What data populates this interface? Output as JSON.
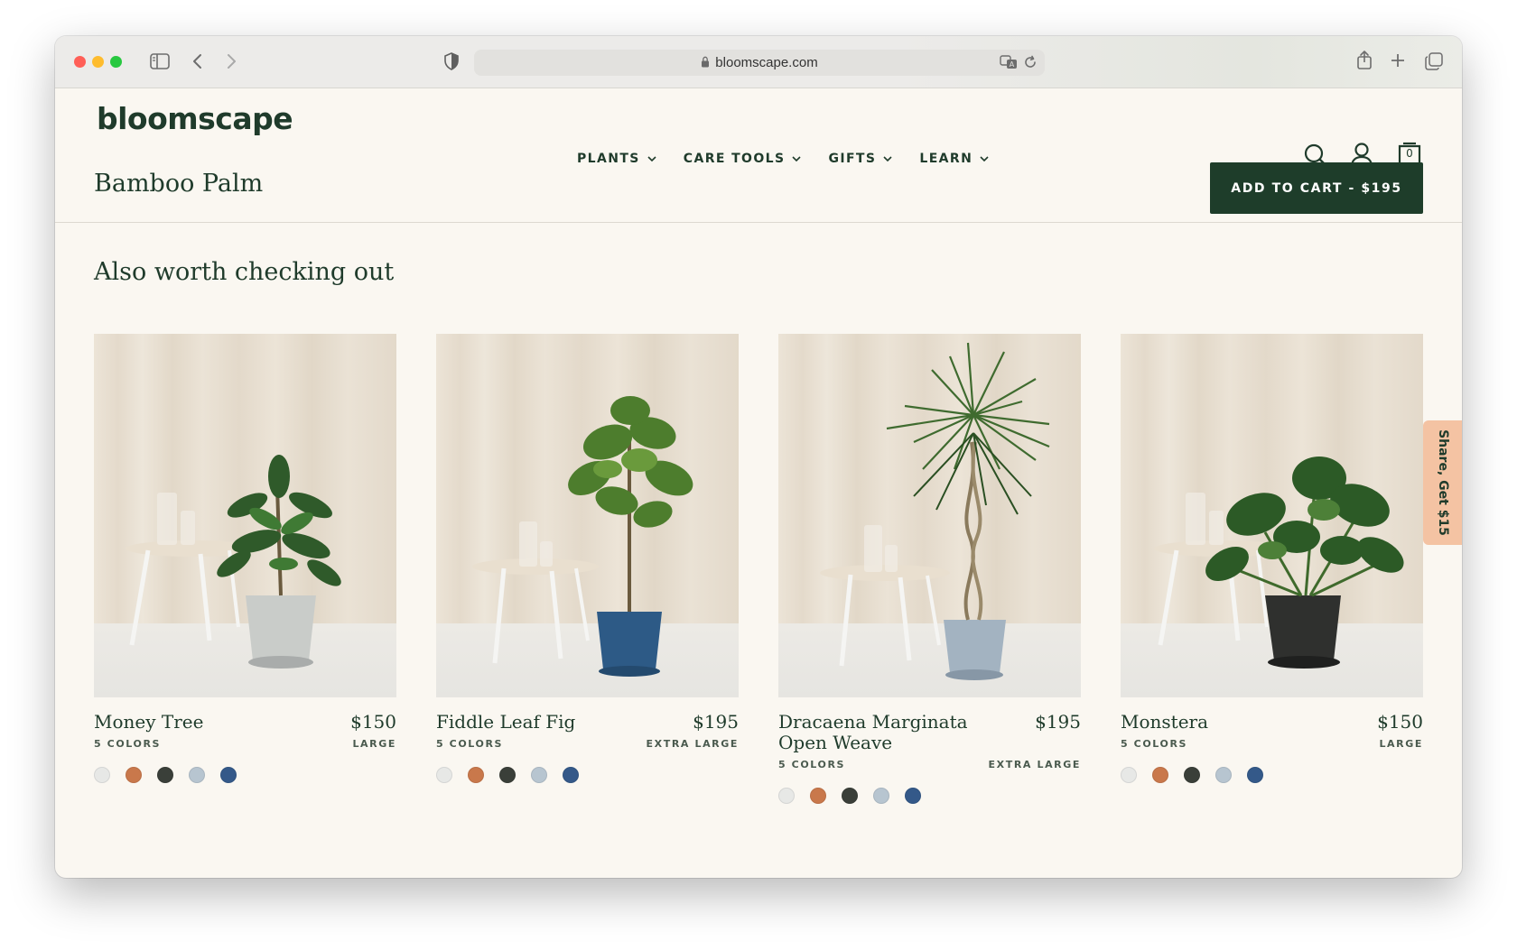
{
  "browser": {
    "url": "bloomscape.com"
  },
  "site": {
    "logo": "bloomscape",
    "nav": [
      {
        "label": "PLANTS"
      },
      {
        "label": "CARE TOOLS"
      },
      {
        "label": "GIFTS"
      },
      {
        "label": "LEARN"
      }
    ],
    "cart_count": "0"
  },
  "product": {
    "title": "Bamboo Palm",
    "add_to_cart_label": "ADD TO CART - $195"
  },
  "recommendations": {
    "title": "Also worth checking out",
    "items": [
      {
        "name": "Money Tree",
        "price": "$150",
        "colors": "5 COLORS",
        "size": "LARGE",
        "pot_color": "#c9ccc9"
      },
      {
        "name": "Fiddle Leaf Fig",
        "price": "$195",
        "colors": "5 COLORS",
        "size": "EXTRA LARGE",
        "pot_color": "#2d5a86"
      },
      {
        "name": "Dracaena Marginata Open Weave",
        "price": "$195",
        "colors": "5 COLORS",
        "size": "EXTRA LARGE",
        "pot_color": "#a3b3c1"
      },
      {
        "name": "Monstera",
        "price": "$150",
        "colors": "5 COLORS",
        "size": "LARGE",
        "pot_color": "#2f302e"
      }
    ],
    "swatch_colors": [
      "#e7e8e6",
      "#c9784b",
      "#3a3f39",
      "#b7c5d0",
      "#345989"
    ]
  },
  "share_tab": {
    "label": "Share, Get $15"
  }
}
